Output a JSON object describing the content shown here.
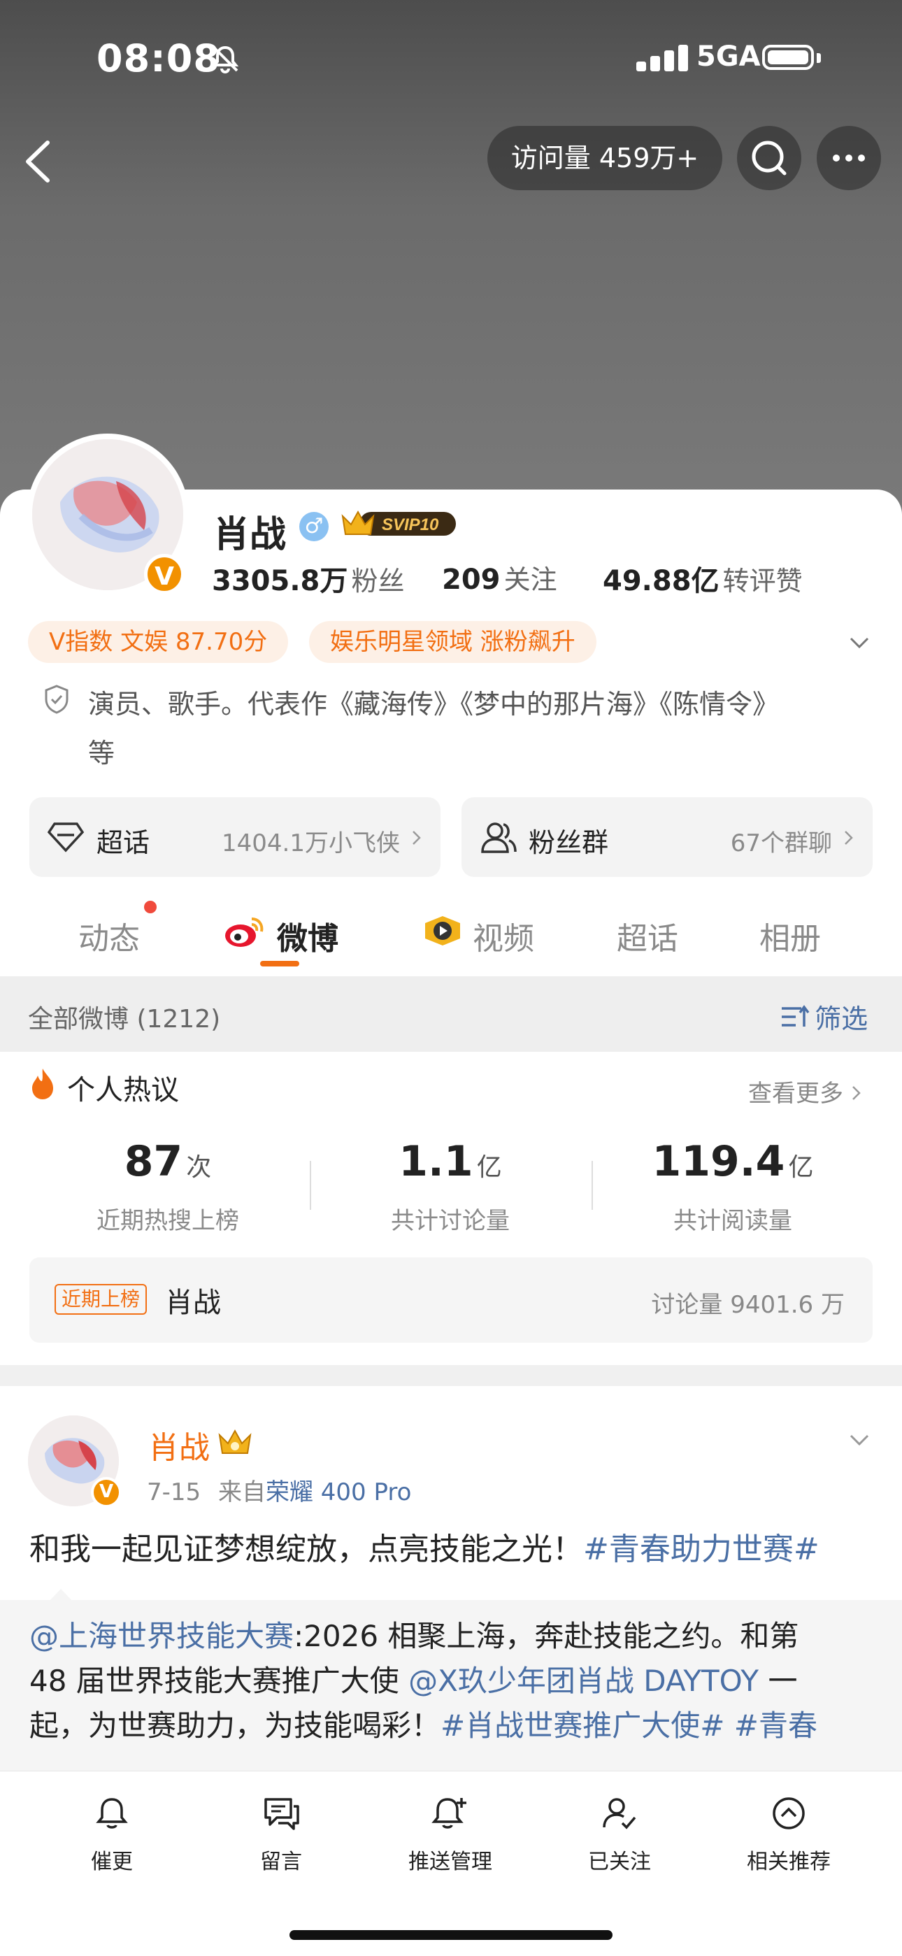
{
  "status_bar": {
    "time": "08:08",
    "network": "5GA"
  },
  "header": {
    "visits": "访问量 459万+"
  },
  "profile": {
    "name": "肖战",
    "svip": "SVIP10",
    "verified_badge": "V",
    "stats": [
      {
        "value": "3305.8万",
        "label": "粉丝"
      },
      {
        "value": "209",
        "label": "关注"
      },
      {
        "value": "49.88亿",
        "label": "转评赞"
      }
    ],
    "chips": [
      "V指数 文娱 87.70分",
      "娱乐明星领域 涨粉飙升"
    ],
    "bio_line1": "演员、歌手。代表作《藏海传》《梦中的那片海》《陈情令》",
    "bio_line2": "等"
  },
  "entries": [
    {
      "title": "超话",
      "sub": "1404.1万小飞侠",
      "icon": "diamond-icon"
    },
    {
      "title": "粉丝群",
      "sub": "67个群聊",
      "icon": "group-icon"
    }
  ],
  "tabs": [
    "动态",
    "微博",
    "视频",
    "超话",
    "相册"
  ],
  "feed_header": {
    "label": "全部微博 (1212)",
    "filter": "筛选"
  },
  "hot": {
    "title": "个人热议",
    "more": "查看更多",
    "metrics": [
      {
        "value": "87",
        "unit": "次",
        "label": "近期热搜上榜"
      },
      {
        "value": "1.1",
        "unit": "亿",
        "label": "共计讨论量"
      },
      {
        "value": "119.4",
        "unit": "亿",
        "label": "共计阅读量"
      }
    ],
    "trend": {
      "tag": "近期上榜",
      "name": "肖战",
      "count": "讨论量 9401.6 万"
    }
  },
  "post": {
    "author": "肖战",
    "date": "7-15",
    "source_prefix": "来自",
    "source_device": "荣耀 400 Pro",
    "text": "和我一起见证梦想绽放，点亮技能之光！",
    "hashtag": "#青春助力世赛#",
    "repost": {
      "mention": "@上海世界技能大赛",
      "line1_rest": ":2026 相聚上海，奔赴技能之约。和第",
      "line2_start": "48 届世界技能大赛推广大使 ",
      "line2_mention": "@X玖少年团肖战 DAYTOY",
      "line2_end": " 一",
      "line3_start": "起，为世赛助力，为技能喝彩！",
      "line3_tags": "#肖战世赛推广大使# #青春"
    }
  },
  "bottom_bar": [
    "催更",
    "留言",
    "推送管理",
    "已关注",
    "相关推荐"
  ],
  "colors": {
    "accent": "#f26f13",
    "link": "#4a6fa5",
    "vip_gold": "#f29100"
  }
}
